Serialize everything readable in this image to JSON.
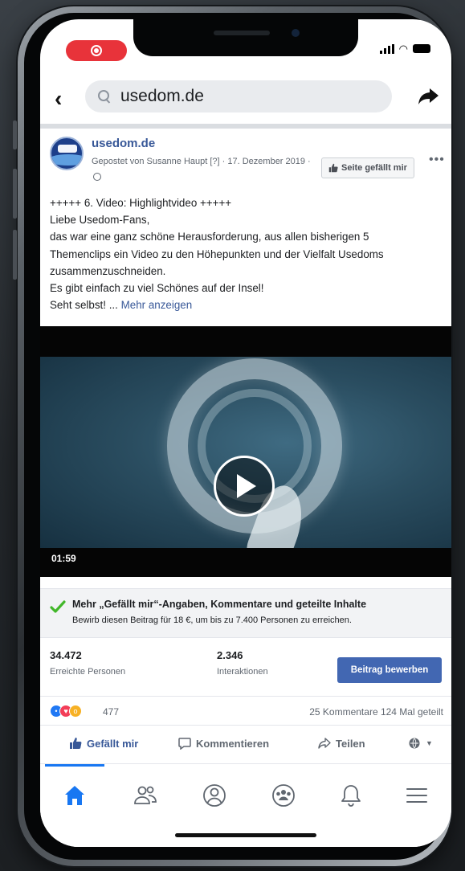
{
  "browser": {
    "url": "usedom.de"
  },
  "post": {
    "page_name": "usedom.de",
    "meta_line": "Gepostet von Susanne Haupt [?] · 17. Dezember 2019 ·",
    "like_page_label": "Seite gefällt mir",
    "more_label": "•••",
    "body_lines": [
      "+++++ 6. Video: Highlightvideo +++++",
      "Liebe Usedom-Fans,",
      "das war eine ganz schöne Herausforderung, aus allen bisherigen 5",
      "Themenclips ein Video zu den Höhepunkten und der Vielfalt Usedoms",
      "zusammenzuschneiden.",
      "Es gibt einfach zu viel Schönes auf der Insel!",
      "Seht selbst! ..."
    ],
    "see_more_label": "Mehr anzeigen",
    "video_duration": "01:59"
  },
  "promotion": {
    "title": "Mehr „Gefällt mir“-Angaben, Kommentare und geteilte Inhalte",
    "subtitle": "Bewirb diesen Beitrag für 18 €, um bis zu 7.400 Personen zu erreichen."
  },
  "stats": {
    "reached_value": "34.472",
    "reached_label": "Erreichte Personen",
    "interactions_value": "2.346",
    "interactions_label": "Interaktionen",
    "promote_button": "Beitrag bewerben"
  },
  "reactions": {
    "count": "477",
    "comments_shares": "25 Kommentare  124 Mal geteilt"
  },
  "actions": {
    "like": "Gefällt mir",
    "comment": "Kommentieren",
    "share": "Teilen"
  },
  "icons": {
    "back": "chevron-left-icon",
    "search": "search-icon",
    "share": "share-arrow-icon",
    "home": "home-icon",
    "friends": "friends-icon",
    "profile": "profile-icon",
    "groups": "groups-icon",
    "notifications": "bell-icon",
    "menu": "hamburger-icon"
  },
  "colors": {
    "facebook_blue": "#4267b2",
    "link_blue": "#385898",
    "active_tab": "#1877f2",
    "record_red": "#e8333a",
    "check_green": "#42b72a"
  }
}
